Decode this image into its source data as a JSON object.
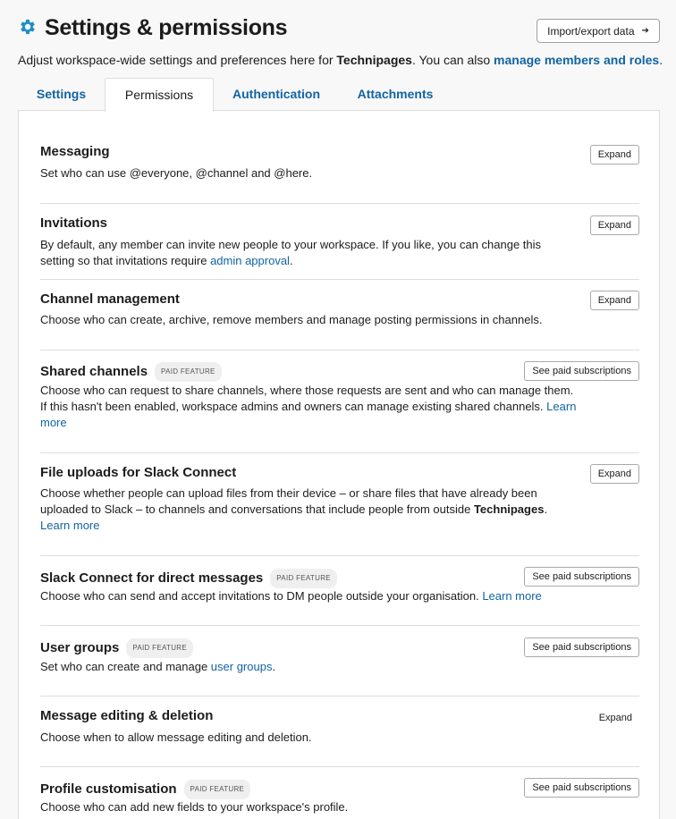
{
  "header": {
    "title": "Settings & permissions",
    "icon": "gear-icon",
    "import_label": "Import/export data",
    "import_arrow": "➔",
    "accent_color": "#1264a3"
  },
  "subtitle": {
    "prefix": "Adjust workspace-wide settings and preferences here for ",
    "workspace": "Technipages",
    "middle": ". You can also ",
    "link": "manage members and roles",
    "suffix": "."
  },
  "tabs": [
    {
      "label": "Settings",
      "active": false
    },
    {
      "label": "Permissions",
      "active": true
    },
    {
      "label": "Authentication",
      "active": false
    },
    {
      "label": "Attachments",
      "active": false
    }
  ],
  "sections": [
    {
      "title": "Messaging",
      "button": "Expand",
      "desc": "Set who can use @everyone, @channel and @here."
    },
    {
      "title": "Invitations",
      "button": "Expand",
      "desc_pre": "By default, any member can invite new people to your workspace. If you like, you can change this setting so that invitations require ",
      "desc_link": "admin approval",
      "desc_post": "."
    },
    {
      "title": "Channel management",
      "button": "Expand",
      "desc": "Choose who can create, archive, remove members and manage posting permissions in channels."
    },
    {
      "title": "Shared channels",
      "badge": "PAID FEATURE",
      "button": "See paid subscriptions",
      "desc_pre": "Choose who can request to share channels, where those requests are sent and who can manage them. If this hasn't been enabled, workspace admins and owners can manage existing shared channels. ",
      "desc_link": "Learn more"
    },
    {
      "title": "File uploads for Slack Connect",
      "button": "Expand",
      "desc_pre": "Choose whether people can upload files from their device – or share files that have already been uploaded to Slack – to channels and conversations that include people from outside ",
      "desc_bold": "Technipages",
      "desc_mid": ". ",
      "desc_link": "Learn more"
    },
    {
      "title": "Slack Connect for direct messages",
      "badge": "PAID FEATURE",
      "button": "See paid subscriptions",
      "desc_pre": "Choose who can send and accept invitations to DM people outside your organisation. ",
      "desc_link": "Learn more"
    },
    {
      "title": "User groups",
      "badge": "PAID FEATURE",
      "button": "See paid subscriptions",
      "desc_pre": "Set who can create and manage ",
      "desc_link": "user groups",
      "desc_post": "."
    },
    {
      "title": "Message editing & deletion",
      "button": "Expand",
      "desc": "Choose when to allow message editing and deletion."
    },
    {
      "title": "Profile customisation",
      "badge": "PAID FEATURE",
      "button": "See paid subscriptions",
      "desc": "Choose who can add new fields to your workspace's profile."
    }
  ]
}
